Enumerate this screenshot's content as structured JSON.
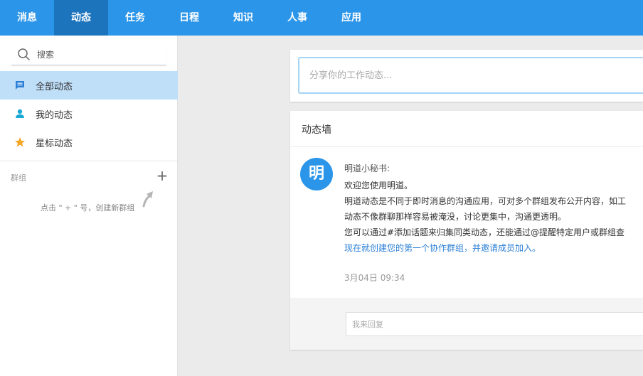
{
  "nav": {
    "items": [
      {
        "label": "消息",
        "active": false
      },
      {
        "label": "动态",
        "active": true
      },
      {
        "label": "任务",
        "active": false
      },
      {
        "label": "日程",
        "active": false
      },
      {
        "label": "知识",
        "active": false
      },
      {
        "label": "人事",
        "active": false
      },
      {
        "label": "应用",
        "active": false
      }
    ]
  },
  "sidebar": {
    "search": {
      "placeholder": "搜索"
    },
    "menu": [
      {
        "label": "全部动态",
        "icon": "message-icon",
        "active": true
      },
      {
        "label": "我的动态",
        "icon": "person-icon",
        "active": false
      },
      {
        "label": "星标动态",
        "icon": "star-icon",
        "active": false
      }
    ],
    "group_label": "群组",
    "group_add": "+",
    "group_hint": "点击 \" + \" 号，创建新群组"
  },
  "share": {
    "placeholder": "分享你的工作动态..."
  },
  "wall": {
    "title": "动态墙",
    "post": {
      "avatar_text": "明",
      "author": "明道小秘书:",
      "lines": [
        "欢迎您使用明道。",
        "明道动态是不同于即时消息的沟通应用，可对多个群组发布公开内容，如工",
        "动态不像群聊那样容易被淹没，讨论更集中，沟通更透明。",
        "您可以通过#添加话题来归集同类动态，还能通过@提醒特定用户或群组查"
      ],
      "link": "现在就创建您的第一个协作群组，并邀请成员加入。",
      "time": "3月04日 09:34"
    },
    "reply": {
      "placeholder": "我来回复"
    }
  },
  "colors": {
    "nav_bg": "#2b95e9",
    "nav_active": "#1c74bd",
    "menu_active": "#bfdff9",
    "link": "#2b7fd6",
    "star": "#f5a623",
    "person": "#1aa9d6"
  }
}
